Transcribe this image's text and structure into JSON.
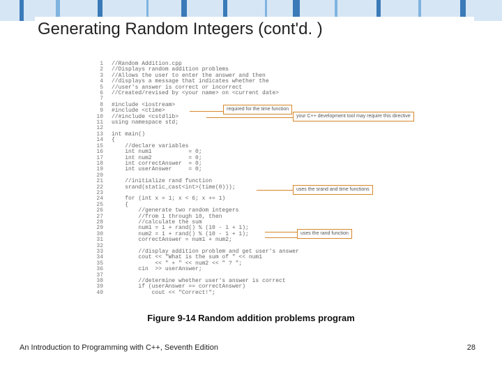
{
  "title": "Generating Random Integers (cont'd. )",
  "code": {
    "lines": [
      "//Random Addition.cpp",
      "//Displays random addition problems",
      "//Allows the user to enter the answer and then",
      "//displays a message that indicates whether the",
      "//user's answer is correct or incorrect",
      "//Created/revised by <your name> on <current date>",
      "",
      "#include <iostream>",
      "#include <ctime>",
      "//#include <cstdlib>",
      "using namespace std;",
      "",
      "int main()",
      "{",
      "    //declare variables",
      "    int num1           = 0;",
      "    int num2           = 0;",
      "    int correctAnswer  = 0;",
      "    int userAnswer     = 0;",
      "",
      "    //initialize rand function",
      "    srand(static_cast<int>(time(0)));",
      "",
      "    for (int x = 1; x < 6; x += 1)",
      "    {",
      "        //generate two random integers",
      "        //from 1 through 10, then",
      "        //calculate the sum",
      "        num1 = 1 + rand() % (10 - 1 + 1);",
      "        num2 = 1 + rand() % (10 - 1 + 1);",
      "        correctAnswer = num1 + num2;",
      "",
      "        //display addition problem and get user's answer",
      "        cout << \"What is the sum of \" << num1",
      "             << \" + \" << num2 << \" ? \";",
      "        cin  >> userAnswer;",
      "",
      "        //determine whether user's answer is correct",
      "        if (userAnswer == correctAnswer)",
      "            cout << \"Correct!\";"
    ]
  },
  "callouts": {
    "c1": {
      "text": "required for the\ntime function"
    },
    "c2": {
      "text": "your C++ development tool\nmay require this directive"
    },
    "c3": {
      "text": "uses the srand\nand time functions"
    },
    "c4": {
      "text": "uses the\nrand function"
    }
  },
  "caption": "Figure 9-14 Random addition problems program",
  "footer": {
    "left": "An Introduction to Programming with C++, Seventh Edition",
    "right": "28"
  }
}
